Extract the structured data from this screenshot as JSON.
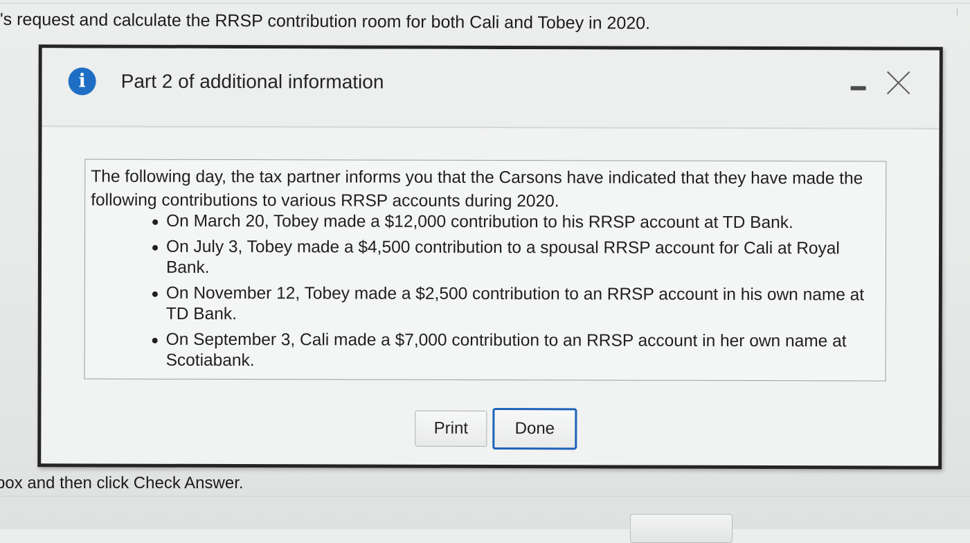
{
  "background": {
    "top_text": "'s request and calculate the RRSP contribution room for both Cali and Tobey in 2020.",
    "bottom_text": "box and then click Check Answer."
  },
  "dialog": {
    "title": "Part 2 of additional information",
    "info_icon_glyph": "i",
    "icons": {
      "info": "info-icon",
      "minimize": "minimize-icon",
      "close": "close-icon"
    },
    "accent_color": "#1e6fc4",
    "intro": "The following day, the tax partner informs you that the Carsons have indicated that they have made the following contributions to various RRSP accounts during 2020.",
    "bullets": [
      "On March 20, Tobey made a $12,000 contribution to his RRSP account at TD Bank.",
      "On July 3, Tobey made a $4,500 contribution to a spousal RRSP account for Cali at Royal Bank.",
      "On November 12, Tobey made a $2,500 contribution to an RRSP account in his own name at TD Bank.",
      "On September 3, Cali made a $7,000 contribution to an RRSP account in her own name at Scotiabank."
    ],
    "buttons": {
      "print": "Print",
      "done": "Done"
    }
  }
}
